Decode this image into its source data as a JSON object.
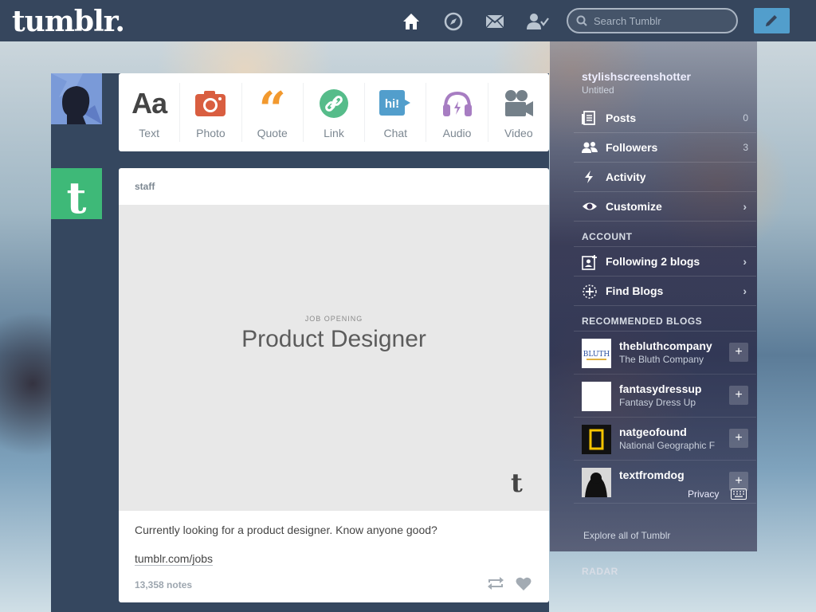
{
  "header": {
    "logo": "tumblr.",
    "search_placeholder": "Search Tumblr",
    "nav": [
      "home-icon",
      "explore-icon",
      "inbox-icon",
      "account-icon"
    ],
    "compose": "pencil-icon"
  },
  "post_types": [
    {
      "label": "Text",
      "icon": "text-icon",
      "color": "#444444"
    },
    {
      "label": "Photo",
      "icon": "camera-icon",
      "color": "#d95e40"
    },
    {
      "label": "Quote",
      "icon": "quote-icon",
      "color": "#f2992e"
    },
    {
      "label": "Link",
      "icon": "link-icon",
      "color": "#56bc8a"
    },
    {
      "label": "Chat",
      "icon": "chat-icon",
      "color": "#529ecc"
    },
    {
      "label": "Audio",
      "icon": "headphones-icon",
      "color": "#a77dc2"
    },
    {
      "label": "Video",
      "icon": "video-camera-icon",
      "color": "#748089"
    }
  ],
  "post": {
    "author": "staff",
    "image_kicker": "JOB OPENING",
    "image_title": "Product Designer",
    "body": "Currently looking for a product designer. Know anyone good?",
    "link": "tumblr.com/jobs",
    "notes": "13,358 notes"
  },
  "sidebar": {
    "blog_name": "stylishscreenshotter",
    "blog_subtitle": "Untitled",
    "items": [
      {
        "label": "Posts",
        "count": "0",
        "icon": "posts-icon"
      },
      {
        "label": "Followers",
        "count": "3",
        "icon": "followers-icon"
      },
      {
        "label": "Activity",
        "count": "",
        "icon": "activity-icon"
      },
      {
        "label": "Customize",
        "count": "",
        "icon": "eye-icon",
        "chevron": "›"
      }
    ],
    "account_header": "ACCOUNT",
    "account_items": [
      {
        "label": "Following 2 blogs",
        "icon": "following-icon",
        "chevron": "›"
      },
      {
        "label": "Find Blogs",
        "icon": "find-blogs-icon",
        "chevron": "›"
      }
    ],
    "recommended_header": "RECOMMENDED BLOGS",
    "recommended": [
      {
        "name": "thebluthcompany",
        "desc": "The Bluth Company"
      },
      {
        "name": "fantasydressup",
        "desc": "Fantasy Dress Up"
      },
      {
        "name": "natgeofound",
        "desc": "National Geographic F"
      },
      {
        "name": "textfromdog",
        "desc": ""
      }
    ],
    "explore": "Explore all of Tumblr",
    "radar_header": "RADAR",
    "privacy": "Privacy"
  },
  "colors": {
    "nav_bg": "#36465d",
    "compose_bg": "#529ecc",
    "staff_avatar": "#3eb978"
  }
}
